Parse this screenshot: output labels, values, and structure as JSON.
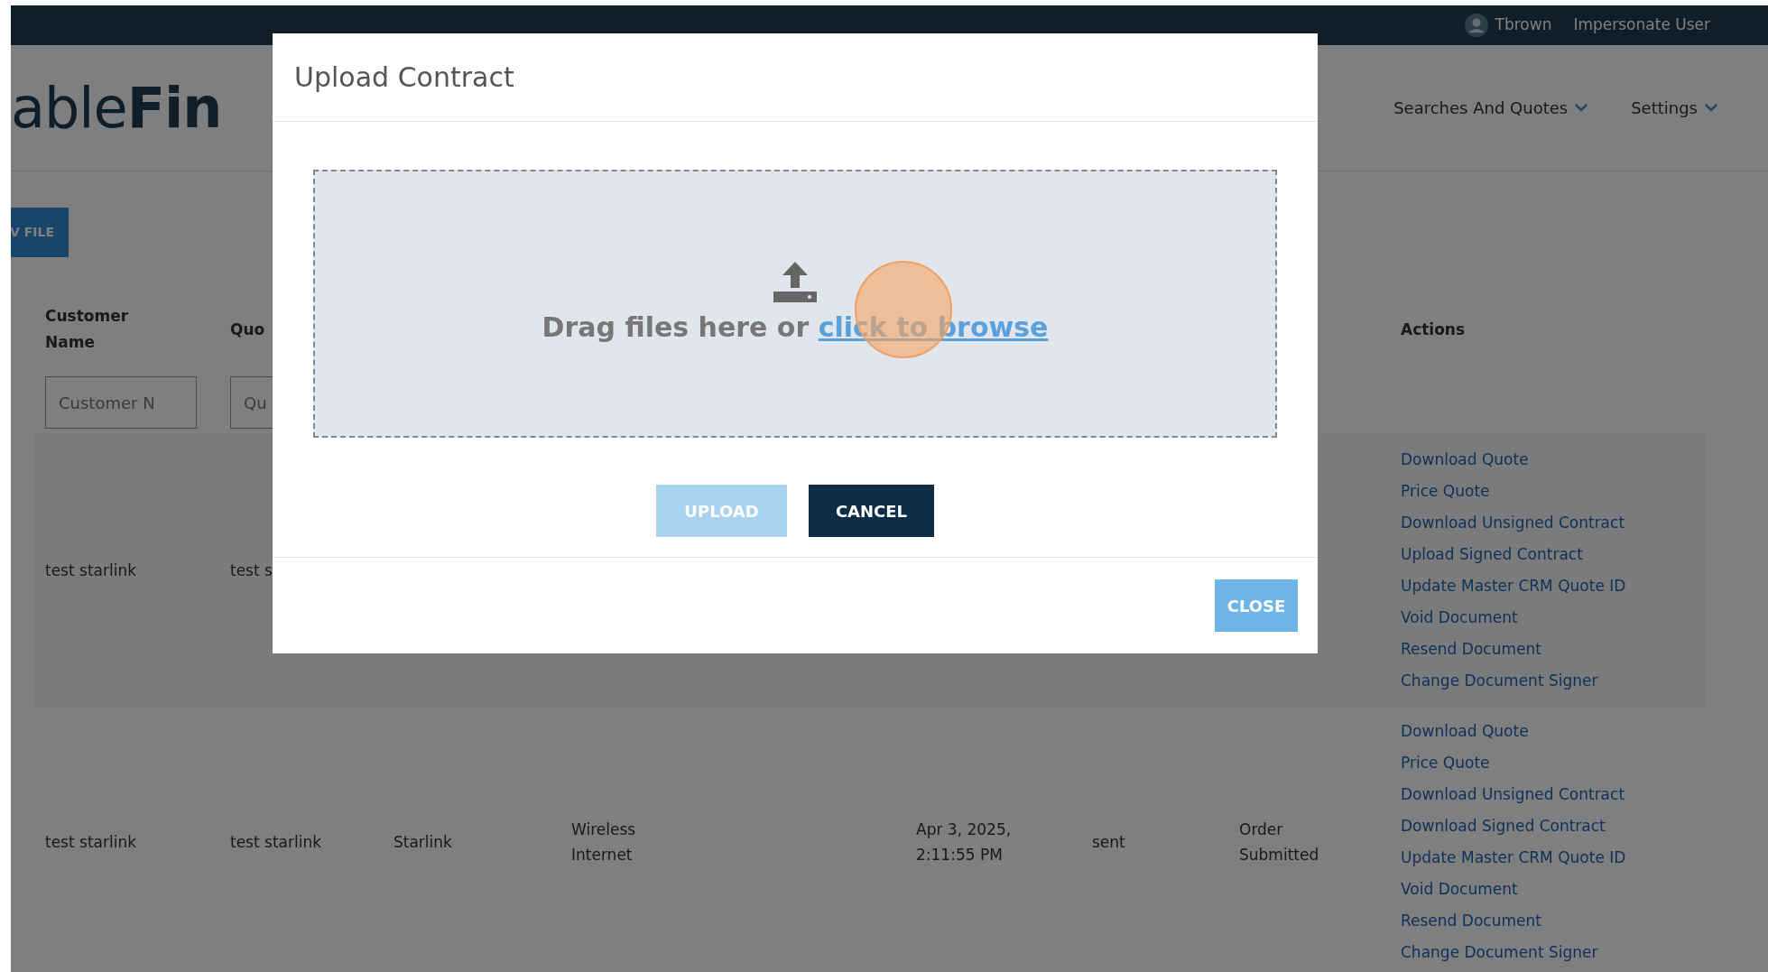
{
  "top_bar": {
    "user": "Tbrown",
    "impersonate": "Impersonate User"
  },
  "header": {
    "logo": "able**Fin**",
    "nav": [
      {
        "label": "Searches And Quotes"
      },
      {
        "label": "Settings"
      }
    ]
  },
  "file_button": "V FILE",
  "table": {
    "columns": [
      {
        "label": "Customer Name"
      },
      {
        "label": "Quo"
      },
      null,
      null,
      null,
      null,
      null,
      {
        "label": "Actions"
      }
    ],
    "filters": [
      {
        "placeholder": "Customer N"
      },
      {
        "placeholder": "Qu"
      }
    ],
    "rows": [
      {
        "cells": [
          "test starlink",
          "test s",
          null,
          null,
          null,
          null,
          null
        ],
        "actions": [
          "Download Quote",
          "Price Quote",
          "Download Unsigned Contract",
          "Upload Signed Contract",
          "Update Master CRM Quote ID",
          "Void Document",
          "Resend Document",
          "Change Document Signer"
        ]
      },
      {
        "cells": [
          "test starlink",
          "test starlink",
          "Starlink",
          "Wireless Internet",
          "Apr 3, 2025, 2:11:55 PM",
          "sent",
          "Order Submitted"
        ],
        "actions": [
          "Download Quote",
          "Price Quote",
          "Download Unsigned Contract",
          "Download Signed Contract",
          "Update Master CRM Quote ID",
          "Void Document",
          "Resend Document",
          "Change Document Signer"
        ]
      }
    ]
  },
  "modal": {
    "title": "Upload Contract",
    "drop_prompt": "Drag files here or",
    "browse_link": "click to browse",
    "upload_button": {
      "label": "UPLOAD",
      "disabled": true
    },
    "cancel_button": {
      "label": "CANCEL",
      "disabled": false
    },
    "close_button": "CLOSE"
  }
}
